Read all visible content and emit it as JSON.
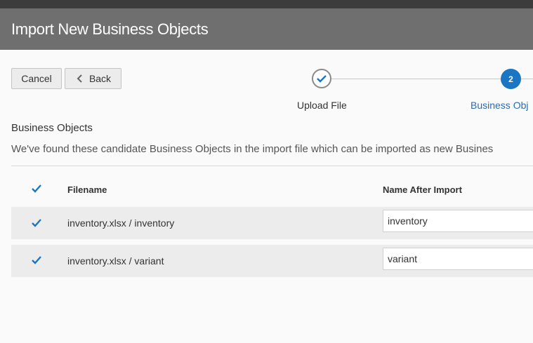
{
  "header": {
    "title": "Import New Business Objects"
  },
  "toolbar": {
    "cancel_label": "Cancel",
    "back_label": "Back"
  },
  "wizard": {
    "steps": [
      {
        "label": "Upload File",
        "status": "completed"
      },
      {
        "number": "2",
        "label": "Business Obj",
        "status": "current"
      }
    ],
    "accent_color": "#1a76c3"
  },
  "section": {
    "title": "Business Objects",
    "description": "We've found these candidate Business Objects in the import file which can be imported as new Busines"
  },
  "table": {
    "columns": [
      "Filename",
      "Name After Import"
    ],
    "select_all_checked": true,
    "rows": [
      {
        "checked": true,
        "filename": "inventory.xlsx / inventory",
        "name_after_import": "inventory"
      },
      {
        "checked": true,
        "filename": "inventory.xlsx / variant",
        "name_after_import": "variant"
      }
    ]
  }
}
